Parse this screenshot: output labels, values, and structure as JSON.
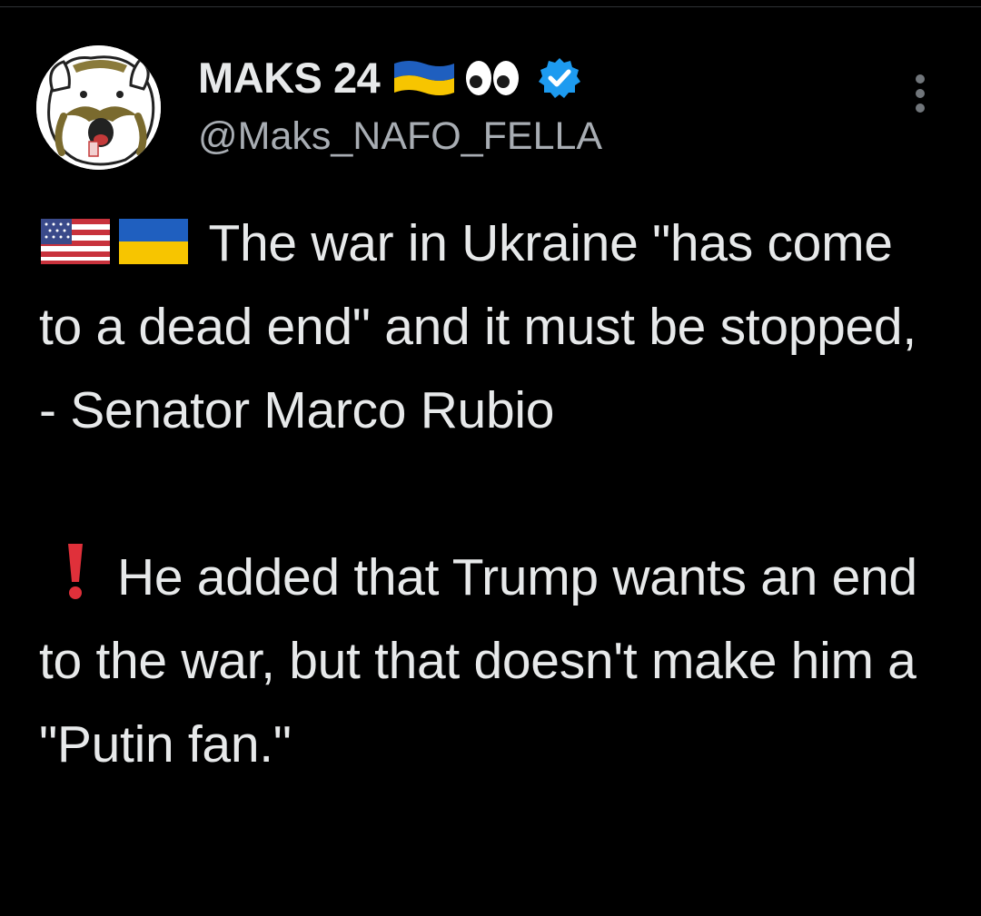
{
  "user": {
    "display_name": "MAKS 24",
    "handle": "@Maks_NAFO_FELLA",
    "verified": true,
    "name_emojis": [
      "ukraine-flag-icon",
      "eyes-icon"
    ]
  },
  "tweet": {
    "paragraphs": [
      {
        "emojis": [
          "us-flag-icon",
          "ukraine-flag-icon"
        ],
        "text": "The war in Ukraine \"has come to a dead end\" and it must be stopped, - Senator Marco Rubio"
      },
      {
        "emojis": [
          "exclamation-icon"
        ],
        "text": "He added that Trump wants an end to the war, but that doesn't make him a \"Putin fan.\""
      }
    ]
  },
  "colors": {
    "background": "#000000",
    "text": "#e7e9ea",
    "handle": "#a8adb3",
    "verified": "#1d9bf0",
    "ukraine_blue": "#1f5fbf",
    "ukraine_yellow": "#f7c500",
    "exclamation": "#e0303a"
  }
}
